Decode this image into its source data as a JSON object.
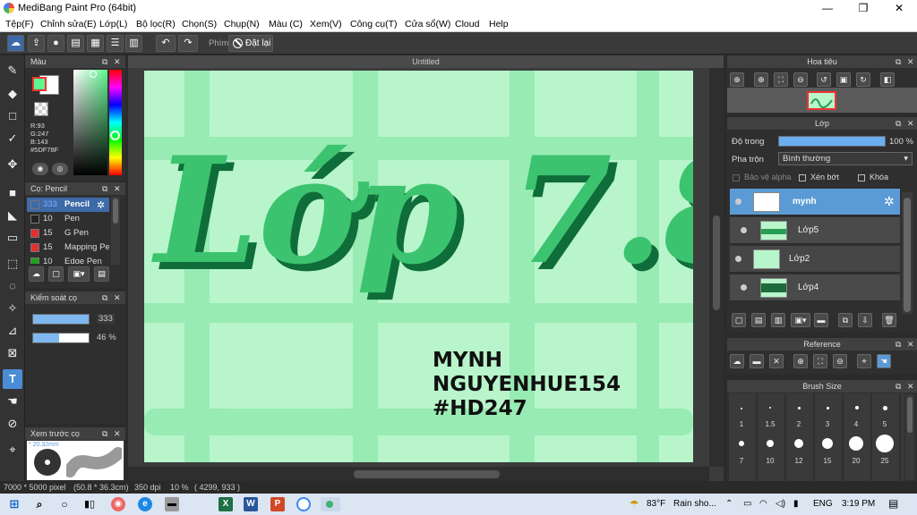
{
  "window": {
    "title": "MediBang Paint Pro (64bit)",
    "minimize": "—",
    "maximize": "❐",
    "close": "✕"
  },
  "menu": [
    "Tệp(F)",
    "Chỉnh sửa(E)",
    "Lớp(L)",
    "Bộ lọc(R)",
    "Chọn(S)",
    "Chụp(N)",
    "Màu (C)",
    "Xem(V)",
    "Công cụ(T)",
    "Cửa sổ(W)",
    "Cloud",
    "Help"
  ],
  "toolbar": {
    "shortcut_label": "Phím",
    "reset_label": "Đặt lại"
  },
  "color_panel": {
    "title": "Màu",
    "fg_color": "#5DF78F",
    "r": "R:93",
    "g": "G:247",
    "b": "B:143",
    "hex": "#5DF78F"
  },
  "brush_panel": {
    "title": "Cọ: Pencil",
    "items": [
      {
        "size": "333",
        "name": "Pencil",
        "color": "#3e6aa8"
      },
      {
        "size": "10",
        "name": "Pen",
        "color": "#222222"
      },
      {
        "size": "15",
        "name": "G Pen",
        "color": "#e03030"
      },
      {
        "size": "15",
        "name": "Mapping Pen",
        "color": "#e03030"
      },
      {
        "size": "10",
        "name": "Edge Pen",
        "color": "#20a020"
      }
    ]
  },
  "brush_control": {
    "title": "Kiểm soát cọ",
    "size_value": "333",
    "opacity_value": "46 %",
    "size_level": 1.0,
    "opacity_level": 0.46
  },
  "preview_panel": {
    "title": "Xem trước cọ",
    "size_label": "* 20.32mm"
  },
  "document": {
    "title": "Untitled"
  },
  "artwork": {
    "main_text": "Lớp 7.8",
    "sub_lines": [
      "MYNH",
      "NGUYENHUE154",
      "#HD247"
    ]
  },
  "navigator": {
    "title": "Hoa tiêu"
  },
  "layer_panel": {
    "title": "Lớp",
    "opacity_label": "Độ trong",
    "opacity_value": "100 %",
    "opacity_level": 1.0,
    "blend_label": "Pha trộn",
    "blend_value": "Bình thường",
    "protect_alpha": "Bảo vệ alpha",
    "clipping": "Xén bớt",
    "lock": "Khóa",
    "layers": [
      "mynh",
      "Lớp5",
      "Lớp2",
      "Lớp4"
    ]
  },
  "reference": {
    "title": "Reference"
  },
  "brush_size": {
    "title": "Brush Size",
    "row1": [
      "1",
      "1.5",
      "2",
      "3",
      "4",
      "5"
    ],
    "row2": [
      "7",
      "10",
      "12",
      "15",
      "20",
      "25"
    ]
  },
  "status": {
    "dimensions": "7000 * 5000 pixel",
    "physical": "(50.8 * 36.3cm)",
    "dpi": "350 dpi",
    "zoom": "10 %",
    "coords": "( 4299, 933 )"
  },
  "taskbar": {
    "temp": "83°F",
    "weather": "Rain sho...",
    "lang": "ENG",
    "time": "3:19 PM"
  }
}
